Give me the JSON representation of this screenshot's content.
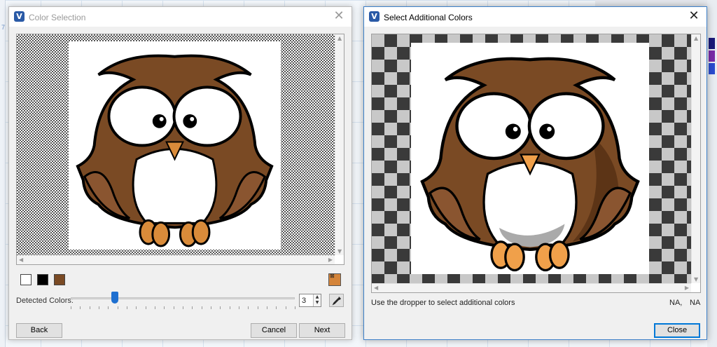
{
  "background": {
    "sidebar_mark": "7"
  },
  "color_selection": {
    "title": "Color Selection",
    "app_icon": "V",
    "swatches": [
      {
        "name": "white",
        "color": "#ffffff"
      },
      {
        "name": "black",
        "color": "#000000"
      },
      {
        "name": "brown",
        "color": "#7a4a24"
      }
    ],
    "transparent_swatch_color": "#d4843a",
    "detected_colors_label": "Detected Colors:",
    "detected_colors_value": "3",
    "back_label": "Back",
    "cancel_label": "Cancel",
    "next_label": "Next"
  },
  "additional_colors": {
    "title": "Select Additional Colors",
    "app_icon": "V",
    "hint": "Use the dropper to select additional colors",
    "coord_x": "NA,",
    "coord_y": "NA",
    "close_label": "Close"
  },
  "icons": {
    "close": "close-icon",
    "dropper": "eyedropper-icon",
    "spin": "spinner-arrows-icon"
  },
  "colors": {
    "accent": "#0078d7",
    "owl_brown": "#7a4a24",
    "owl_dark": "#5c3416",
    "beak": "#d98b3a"
  }
}
